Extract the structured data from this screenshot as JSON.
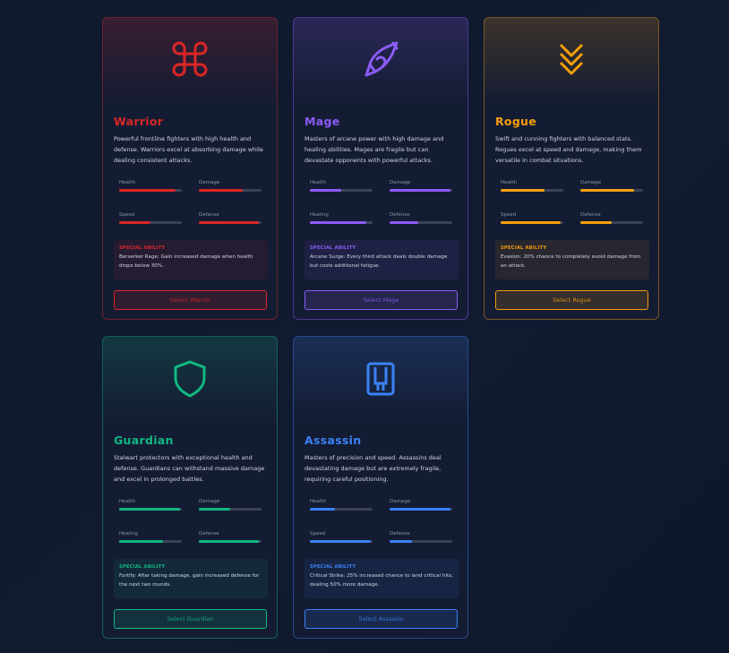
{
  "classes": [
    {
      "key": "warrior",
      "name": "Warrior",
      "icon": "command-icon",
      "accent": "#dc2626",
      "description": "Powerful frontline fighters with high health and defense. Warriors excel at absorbing damage while dealing consistent attacks.",
      "stats": [
        {
          "label": "Health",
          "value": 0.9
        },
        {
          "label": "Damage",
          "value": 0.7
        },
        {
          "label": "Speed",
          "value": 0.5
        },
        {
          "label": "Defense",
          "value": 0.95
        }
      ],
      "ability_title": "SPECIAL ABILITY",
      "ability_text": "Berserker Rage: Gain increased damage when health drops below 30%.",
      "button_label": "Select Warrior"
    },
    {
      "key": "mage",
      "name": "Mage",
      "icon": "feather-icon",
      "accent": "#8b5cf6",
      "description": "Masters of arcane power with high damage and healing abilities. Mages are fragile but can devastate opponents with powerful attacks.",
      "stats": [
        {
          "label": "Health",
          "value": 0.5
        },
        {
          "label": "Damage",
          "value": 0.97
        },
        {
          "label": "Healing",
          "value": 0.9
        },
        {
          "label": "Defense",
          "value": 0.45
        }
      ],
      "ability_title": "SPECIAL ABILITY",
      "ability_text": "Arcane Surge: Every third attack deals double damage but costs additional fatigue.",
      "button_label": "Select Mage"
    },
    {
      "key": "rogue",
      "name": "Rogue",
      "icon": "chevrons-down-icon",
      "accent": "#f59e0b",
      "description": "Swift and cunning fighters with balanced stats. Rogues excel at speed and damage, making them versatile in combat situations.",
      "stats": [
        {
          "label": "Health",
          "value": 0.7
        },
        {
          "label": "Damage",
          "value": 0.85
        },
        {
          "label": "Speed",
          "value": 0.95
        },
        {
          "label": "Defense",
          "value": 0.5
        }
      ],
      "ability_title": "SPECIAL ABILITY",
      "ability_text": "Evasion: 20% chance to completely avoid damage from an attack.",
      "button_label": "Select Rogue"
    },
    {
      "key": "guardian",
      "name": "Guardian",
      "icon": "shield-icon",
      "accent": "#10b981",
      "description": "Stalwart protectors with exceptional health and defense. Guardians can withstand massive damage and excel in prolonged battles.",
      "stats": [
        {
          "label": "Health",
          "value": 0.97
        },
        {
          "label": "Damage",
          "value": 0.5
        },
        {
          "label": "Healing",
          "value": 0.7
        },
        {
          "label": "Defense",
          "value": 0.95
        }
      ],
      "ability_title": "SPECIAL ABILITY",
      "ability_text": "Fortify: After taking damage, gain increased defense for the next two rounds.",
      "button_label": "Select Guardian"
    },
    {
      "key": "assassin",
      "name": "Assassin",
      "icon": "door-icon",
      "accent": "#3b82f6",
      "description": "Masters of precision and speed. Assassins deal devastating damage but are extremely fragile, requiring careful positioning.",
      "stats": [
        {
          "label": "Health",
          "value": 0.4
        },
        {
          "label": "Damage",
          "value": 0.97
        },
        {
          "label": "Speed",
          "value": 0.97
        },
        {
          "label": "Defense",
          "value": 0.35
        }
      ],
      "ability_title": "SPECIAL ABILITY",
      "ability_text": "Critical Strike: 25% increased chance to land critical hits, dealing 50% more damage.",
      "button_label": "Select Assassin"
    }
  ]
}
